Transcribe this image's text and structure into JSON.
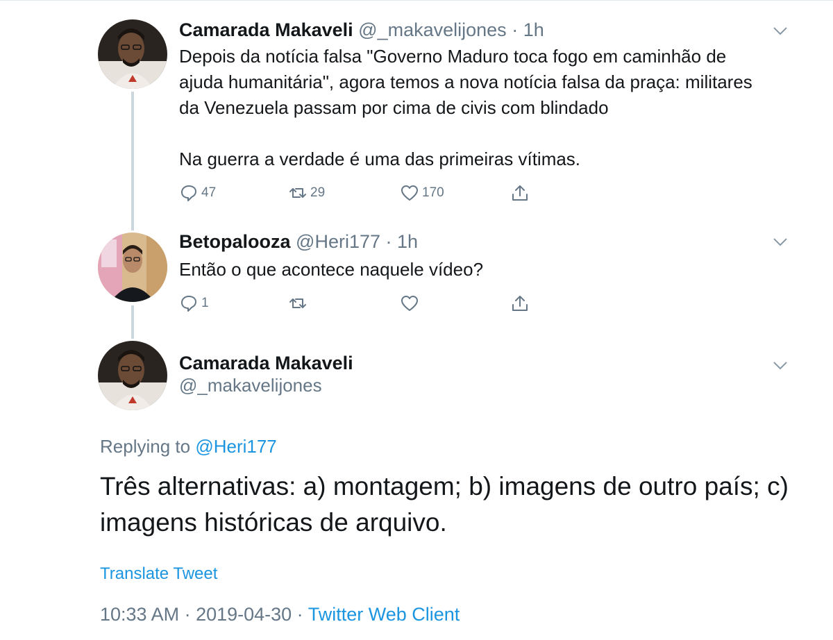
{
  "tweets": [
    {
      "name": "Camarada Makaveli",
      "handle": "@_makavelijones",
      "time": "· 1h",
      "text_lines": [
        "Depois da notícia falsa \"Governo Maduro toca fogo em caminhão de",
        "ajuda humanitária\", agora temos a nova notícia falsa da praça: militares",
        "da Venezuela passam por cima de civis com blindado",
        "",
        "Na guerra a verdade é uma das primeiras vítimas."
      ],
      "replies": "47",
      "retweets": "29",
      "likes": "170"
    },
    {
      "name": "Betopalooza",
      "handle": "@Heri177",
      "time": "· 1h",
      "text": "Então o que acontece naquele vídeo?",
      "replies": "1",
      "retweets": "",
      "likes": ""
    }
  ],
  "focused": {
    "name": "Camarada Makaveli",
    "handle": "@_makavelijones",
    "replying_prefix": "Replying to",
    "replying_to": "@Heri177",
    "text_line1": "Três alternativas: a) montagem; b) imagens de outro país; c)",
    "text_line2": "imagens históricas de arquivo.",
    "translate": "Translate Tweet",
    "timestamp": "10:33 AM · 2019-04-30 · ",
    "client": "Twitter Web Client"
  },
  "colors": {
    "link": "#1b95e0",
    "secondary_text": "#657786",
    "primary_text": "#14171a",
    "thread_line": "#ccd6dd"
  },
  "icons": {
    "reply": "speech-bubble-icon",
    "retweet": "retweet-arrows-icon",
    "like": "heart-icon",
    "share": "share-upload-icon",
    "menu": "chevron-down-icon"
  }
}
